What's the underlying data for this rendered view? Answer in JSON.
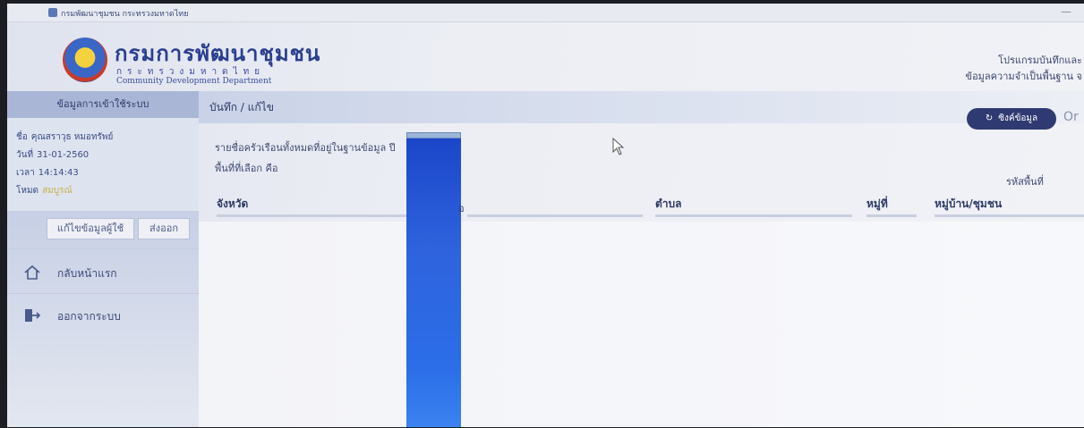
{
  "window": {
    "title": "กรมพัฒนาชุมชน กระทรวงมหาดไทย",
    "minimize": "—"
  },
  "header": {
    "dept_name": "กรมการพัฒนาชุมชน",
    "ministry": "กระทรวงมหาดไทย",
    "dept_english": "Community Development Department",
    "program_line1": "โปรแกรมบันทึกและ",
    "program_line2": "ข้อมูลความจำเป็นพื้นฐาน จ"
  },
  "sidebar": {
    "login_header": "ข้อมูลการเข้าใช้ระบบ",
    "name_label": "ชื่อ",
    "name_value": "คุณสราวุธ หมอทรัพย์",
    "date_label": "วันที่",
    "date_value": "31-01-2560",
    "time_label": "เวลา",
    "time_value": "14:14:43",
    "mode_label": "โหมด",
    "mode_value": "สมบูรณ์",
    "edit_user_button": "แก้ไขข้อมูลผู้ใช้",
    "export_button": "ส่งออก",
    "nav": {
      "home": "กลับหน้าแรก",
      "logout": "ออกจากระบบ"
    }
  },
  "main": {
    "breadcrumb": "บันทึก / แก้ไข",
    "sync_button": "ซิงค์ข้อมูล",
    "or_text": "Or",
    "description_line1": "รายชื่อครัวเรือนทั้งหมดที่อยู่ในฐานข้อมูล ปี",
    "description_line2": "พื้นที่ที่เลือก คือ",
    "area_code_label": "รหัสพื้นที่",
    "table": {
      "columns": [
        "จังหวัด",
        "อ",
        "ตำบล",
        "หมู่ที่",
        "หมู่บ้าน/ชุมชน"
      ]
    }
  },
  "colors": {
    "accent": "#2f3a73",
    "sidebar_bg": "#c9d1e6",
    "blue_tape": "#2e63dd"
  }
}
